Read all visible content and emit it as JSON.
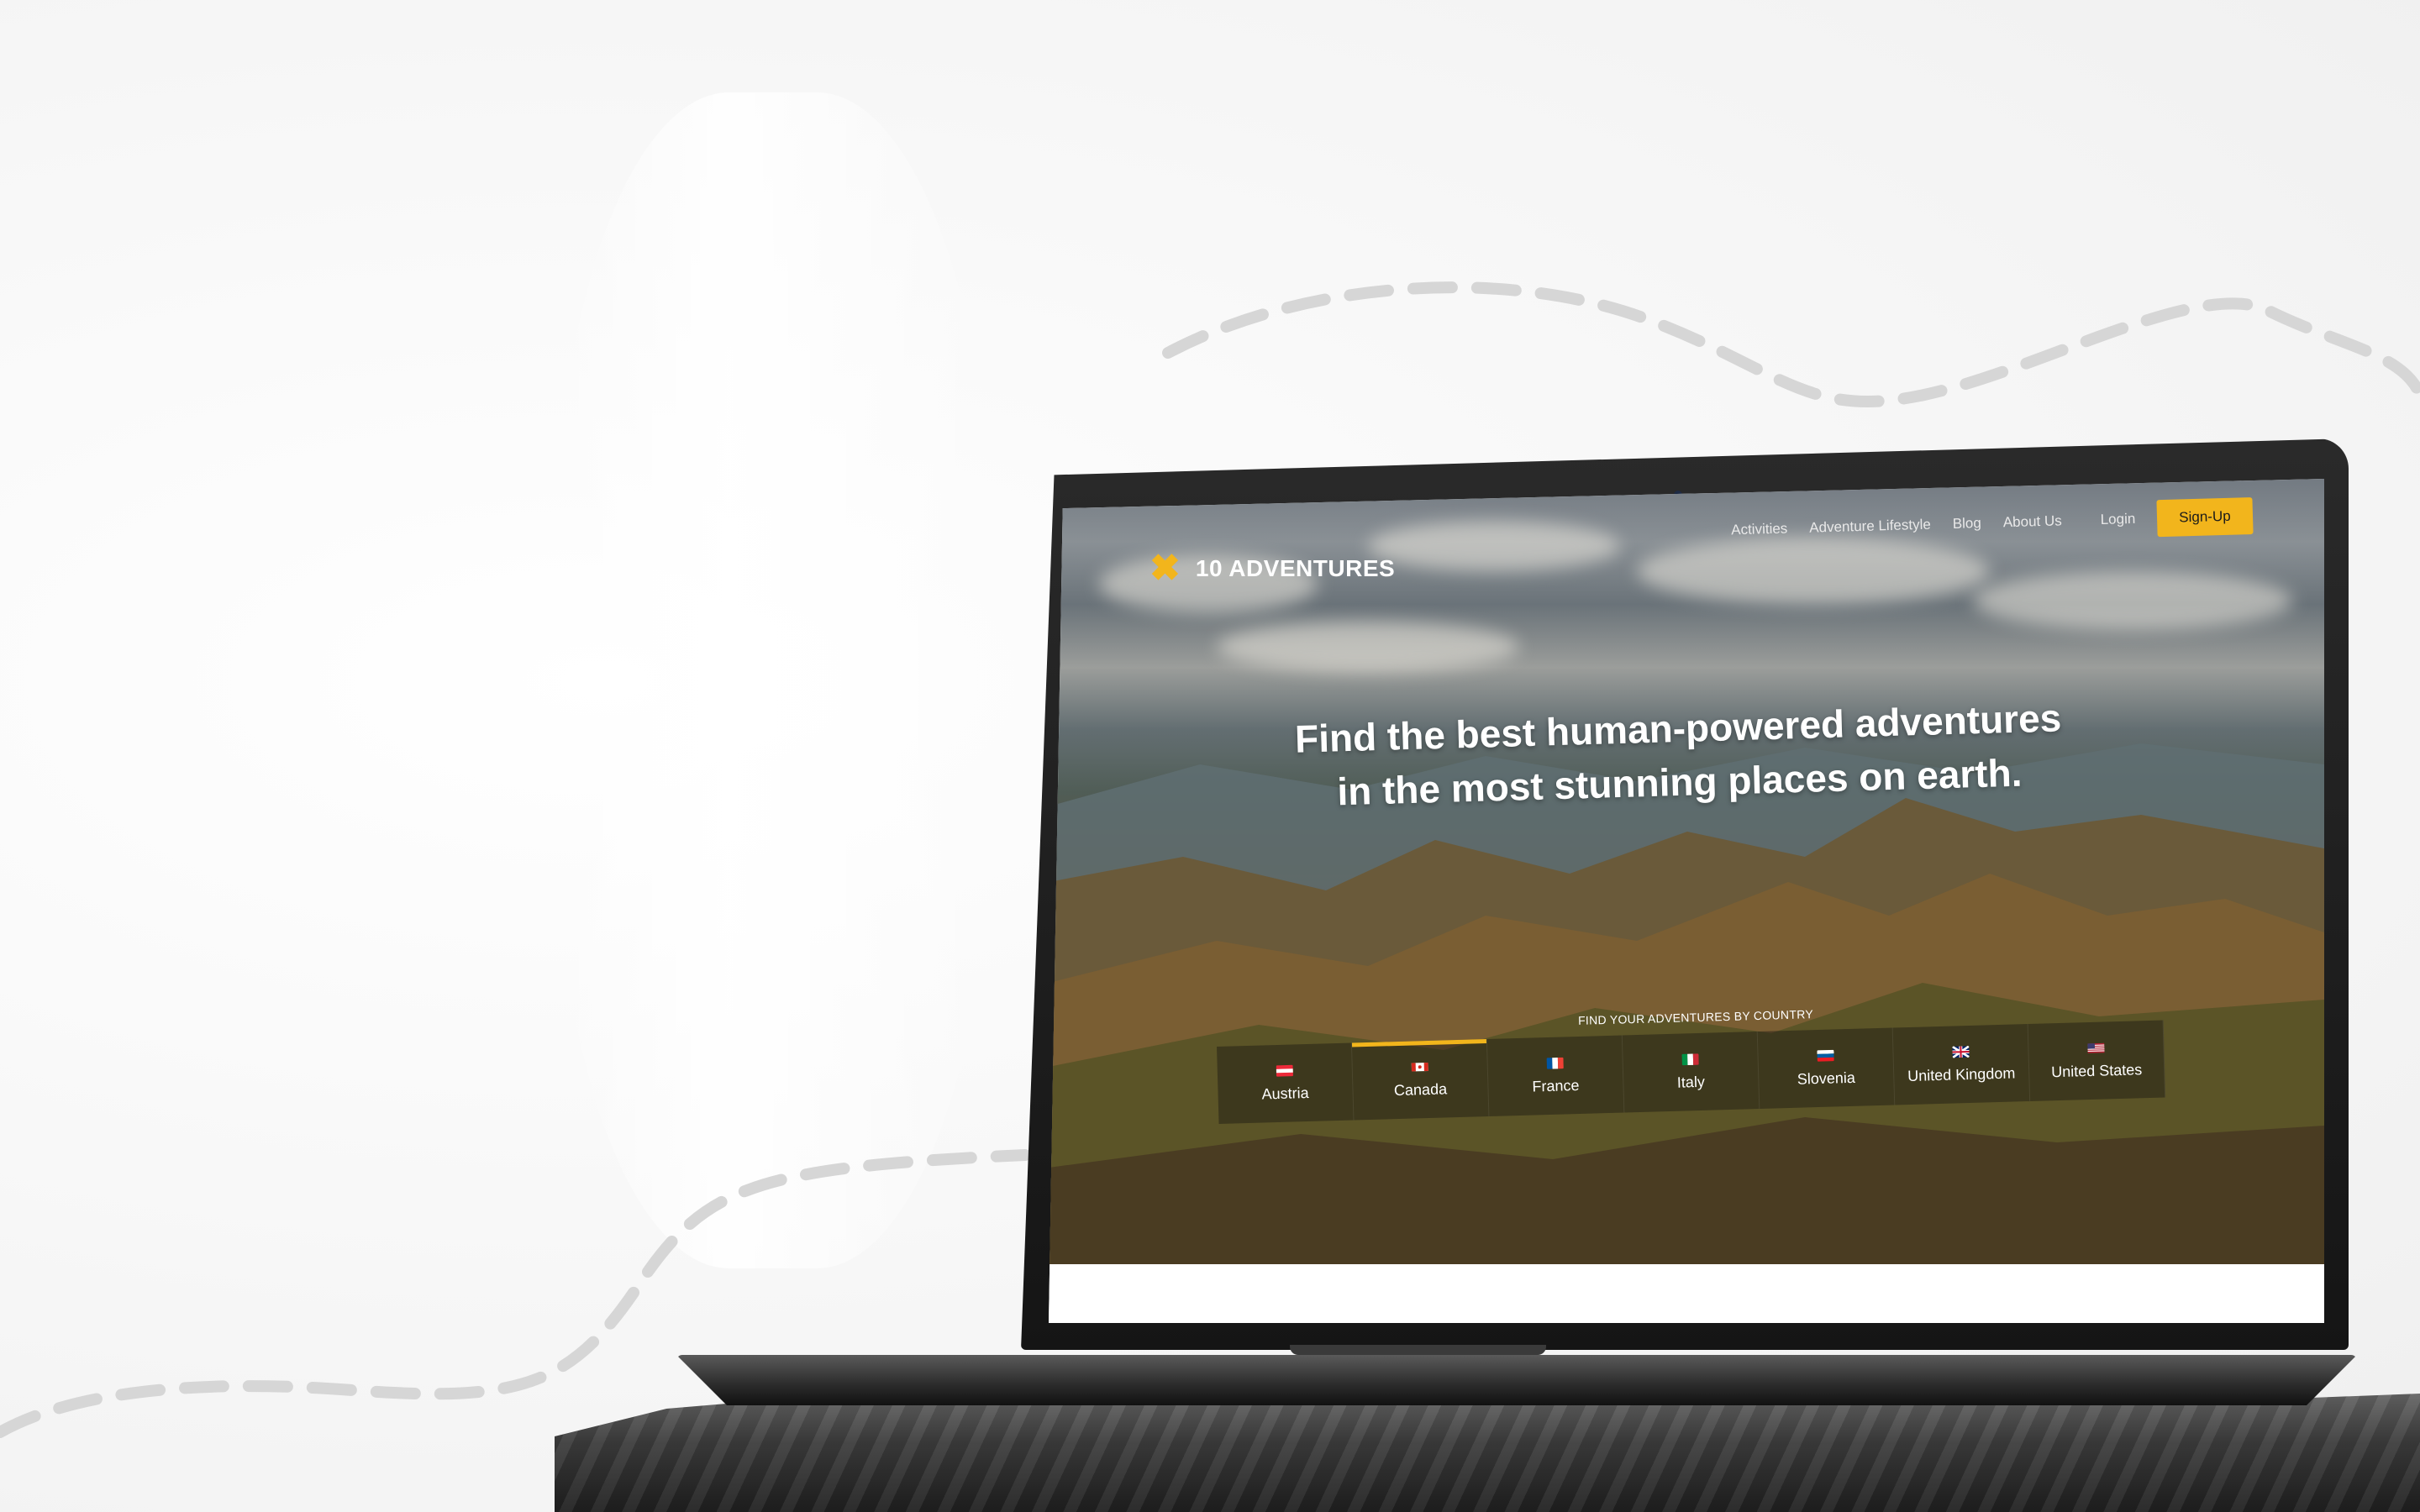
{
  "brand": {
    "name": "10 ADVENTURES",
    "logo_icon": "x-mark-icon",
    "accent": "#f2b51c"
  },
  "nav": {
    "items": [
      "Activities",
      "Adventure Lifestyle",
      "Blog",
      "About Us"
    ],
    "login": "Login",
    "signup": "Sign-Up"
  },
  "hero": {
    "headline_line1": "Find the best human-powered adventures",
    "headline_line2": "in the most stunning places on earth."
  },
  "countries": {
    "label": "FIND YOUR ADVENTURES BY COUNTRY",
    "active": "Canada",
    "items": [
      {
        "name": "Austria",
        "flag": "austria-flag-icon"
      },
      {
        "name": "Canada",
        "flag": "canada-flag-icon"
      },
      {
        "name": "France",
        "flag": "france-flag-icon"
      },
      {
        "name": "Italy",
        "flag": "italy-flag-icon"
      },
      {
        "name": "Slovenia",
        "flag": "slovenia-flag-icon"
      },
      {
        "name": "United Kingdom",
        "flag": "uk-flag-icon"
      },
      {
        "name": "United States",
        "flag": "us-flag-icon"
      }
    ]
  }
}
